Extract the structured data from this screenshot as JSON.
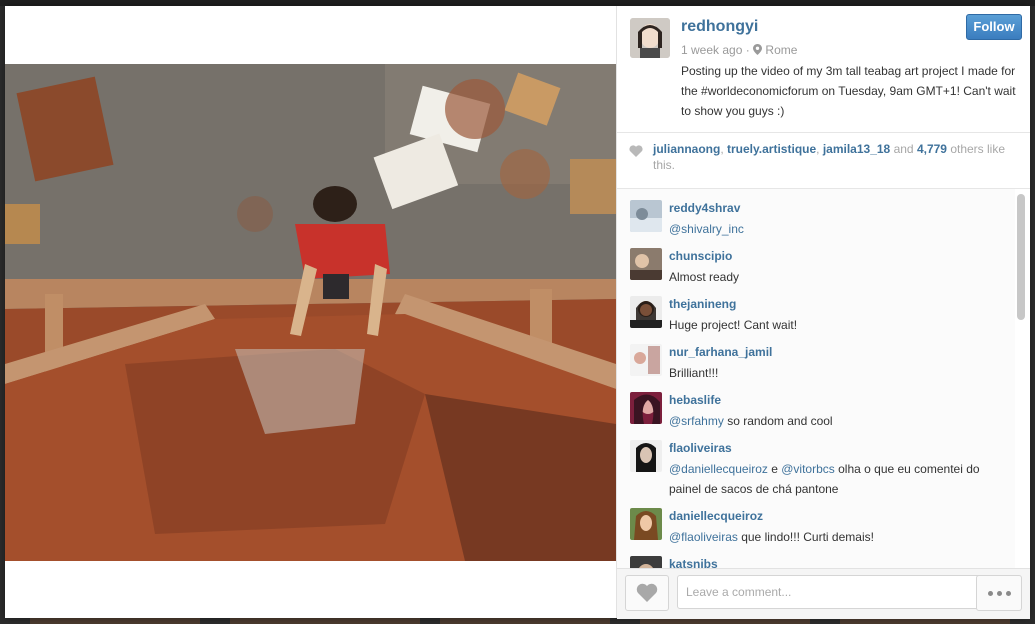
{
  "post": {
    "username": "redhongyi",
    "time_ago": "1 week ago",
    "location": "Rome",
    "caption": "Posting up the video of my 3m tall teabag art project I made for the #worldeconomicforum on Tuesday, 9am GMT+1! Can't wait to show you guys :)",
    "follow_label": "Follow"
  },
  "likes": {
    "user1": "juliannaong",
    "user2": "truely.artistique",
    "user3": "jamila13_18",
    "and_text": "and",
    "count": "4,779",
    "suffix": "others like this."
  },
  "comments": [
    {
      "user": "reddy4shrav",
      "mention": "@shivalry_inc",
      "text": ""
    },
    {
      "user": "chunscipio",
      "text": "Almost ready"
    },
    {
      "user": "thejanineng",
      "text": "Huge project! Cant wait!"
    },
    {
      "user": "nur_farhana_jamil",
      "text": "Brilliant!!!"
    },
    {
      "user": "hebaslife",
      "mention": "@srfahmy",
      "text": " so random and cool"
    },
    {
      "user": "flaoliveiras",
      "mention": "@daniellecqueiroz",
      "mid": " e ",
      "mention2": "@vitorbcs",
      "text": " olha o que eu comentei do painel de sacos de chá pantone"
    },
    {
      "user": "daniellecqueiroz",
      "mention": "@flaoliveiras",
      "text": " que lindo!!! Curti demais!"
    },
    {
      "user": "katsnibs"
    }
  ],
  "comment_box": {
    "placeholder": "Leave a comment..."
  },
  "icons": {
    "location": "pin-icon",
    "like": "heart-icon",
    "more": "ellipsis-icon"
  },
  "colors": {
    "link": "#3f729b",
    "follow_button": "#4a8ccc"
  }
}
